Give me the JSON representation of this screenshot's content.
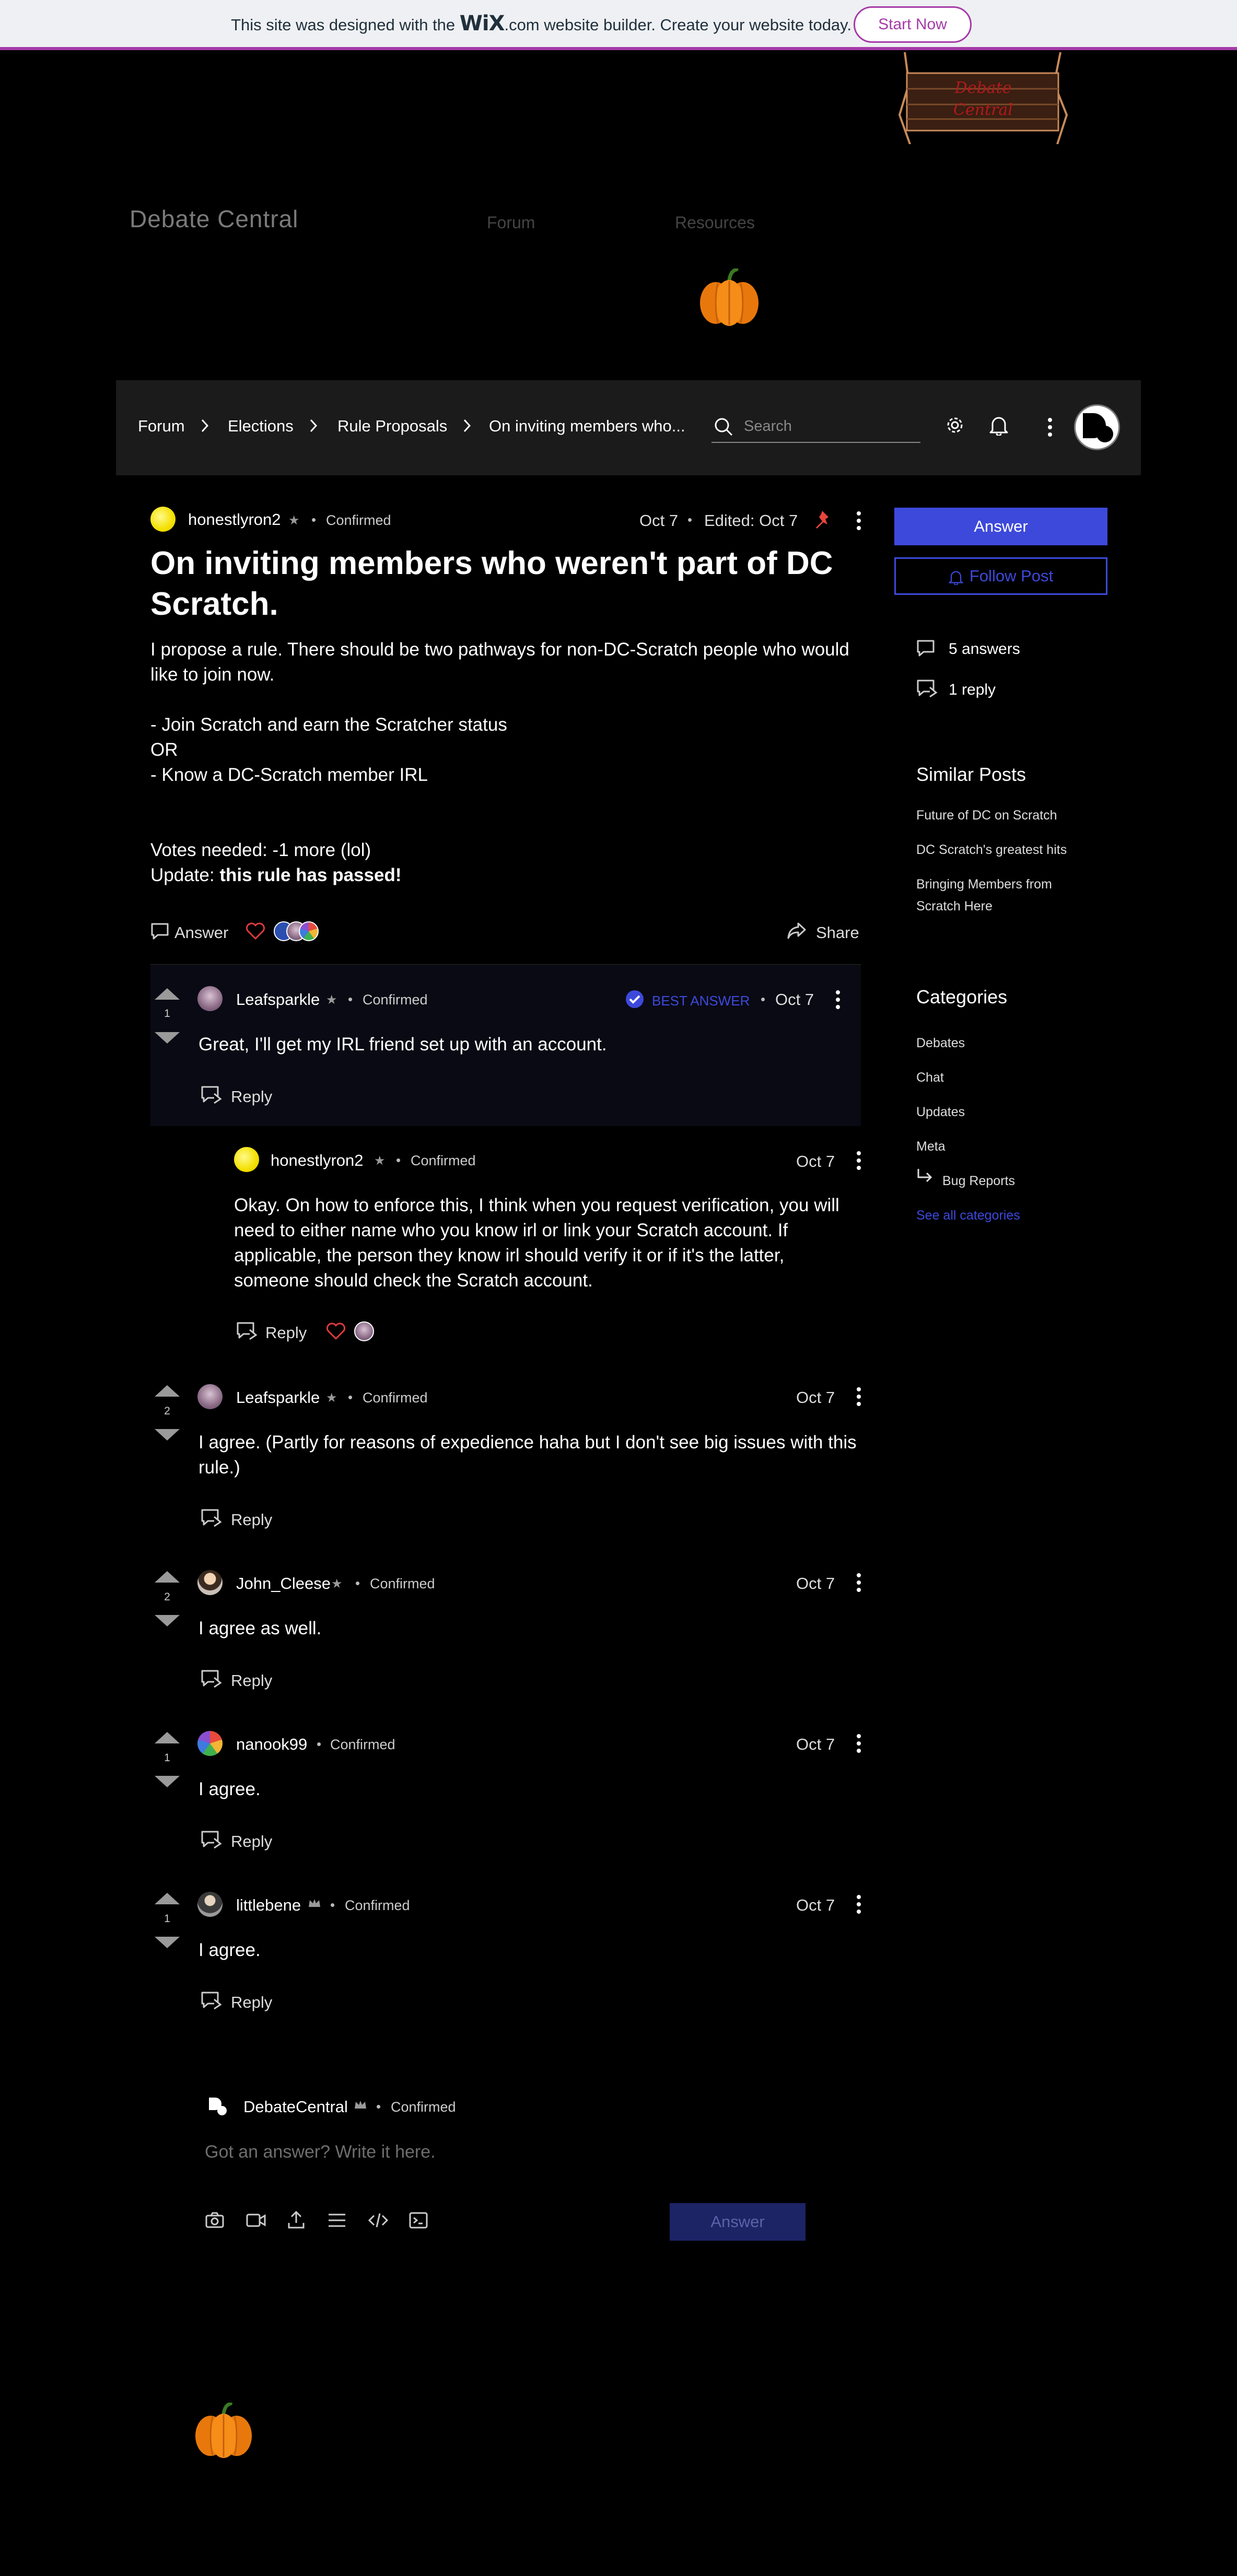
{
  "banner": {
    "text_before": "This site was designed with the ",
    "brand": "WiX",
    "text_after": ".com website builder. Create your website today.",
    "cta": "Start Now"
  },
  "header": {
    "site_title": "Debate Central",
    "nav": [
      "Forum",
      "Resources"
    ],
    "logo_text": [
      "Debate",
      "Central"
    ]
  },
  "breadcrumb": [
    "Forum",
    "Elections",
    "Rule Proposals",
    "On inviting members who..."
  ],
  "search": {
    "placeholder": "Search"
  },
  "post": {
    "author": "honestlyron2",
    "badge": "Confirmed",
    "date": "Oct 7",
    "edited": "Edited: Oct 7",
    "title": "On inviting members who weren't part of DC Scratch.",
    "body": [
      "I propose a rule. There should be two pathways for non-DC-Scratch people who would like to join now.",
      "- Join Scratch and earn the Scratcher status",
      "OR",
      "- Know a DC-Scratch member IRL",
      "Votes needed: -1 more (lol)"
    ],
    "update_label": "Update: ",
    "update_bold": "this rule has passed!",
    "answer_action": "Answer",
    "share_action": "Share"
  },
  "comments": [
    {
      "author": "Leafsparkle",
      "badge": "Confirmed",
      "best": "BEST ANSWER",
      "date": "Oct 7",
      "votes": "1",
      "text": "Great, I'll get my IRL friend set up with an account.",
      "reply": "Reply"
    },
    {
      "author": "Leafsparkle",
      "badge": "Confirmed",
      "date": "Oct 7",
      "votes": "2",
      "text": "I agree. (Partly for reasons of expedience haha but I don't see big issues with this rule.)",
      "reply": "Reply"
    },
    {
      "author": "John_Cleese",
      "badge": "Confirmed",
      "date": "Oct 7",
      "votes": "2",
      "text": "I agree as well.",
      "reply": "Reply"
    },
    {
      "author": "nanook99",
      "badge": "Confirmed",
      "date": "Oct 7",
      "votes": "1",
      "text": "I agree.",
      "reply": "Reply"
    },
    {
      "author": "littlebene",
      "badge": "Confirmed",
      "date": "Oct 7",
      "votes": "1",
      "text": "I agree.",
      "reply": "Reply"
    }
  ],
  "nested_reply": {
    "author": "honestlyron2",
    "badge": "Confirmed",
    "date": "Oct 7",
    "text": "Okay. On how to enforce this, I think when you request verification, you will need to either name who you know irl or link your Scratch account. If applicable, the person they know irl should verify it or if it's the latter, someone should check the Scratch account.",
    "reply": "Reply"
  },
  "sidebar": {
    "answer_button": "Answer",
    "follow_button": "Follow Post",
    "answers_count": "5 answers",
    "replies_count": "1 reply",
    "similar_title": "Similar Posts",
    "similar": [
      "Future of DC on Scratch",
      "DC Scratch's greatest hits",
      "Bringing Members from Scratch Here"
    ],
    "categories_title": "Categories",
    "categories": [
      "Debates",
      "Chat",
      "Updates",
      "Meta"
    ],
    "sub_category": "Bug Reports",
    "see_all": "See all categories"
  },
  "composer": {
    "author": "DebateCentral",
    "badge": "Confirmed",
    "placeholder": "Got an answer? Write it here.",
    "submit": "Answer"
  },
  "colors": {
    "accent": "#3d49db",
    "wix_purple": "#a53ba8",
    "heart": "#e03b3b",
    "pin": "#e8453c"
  }
}
